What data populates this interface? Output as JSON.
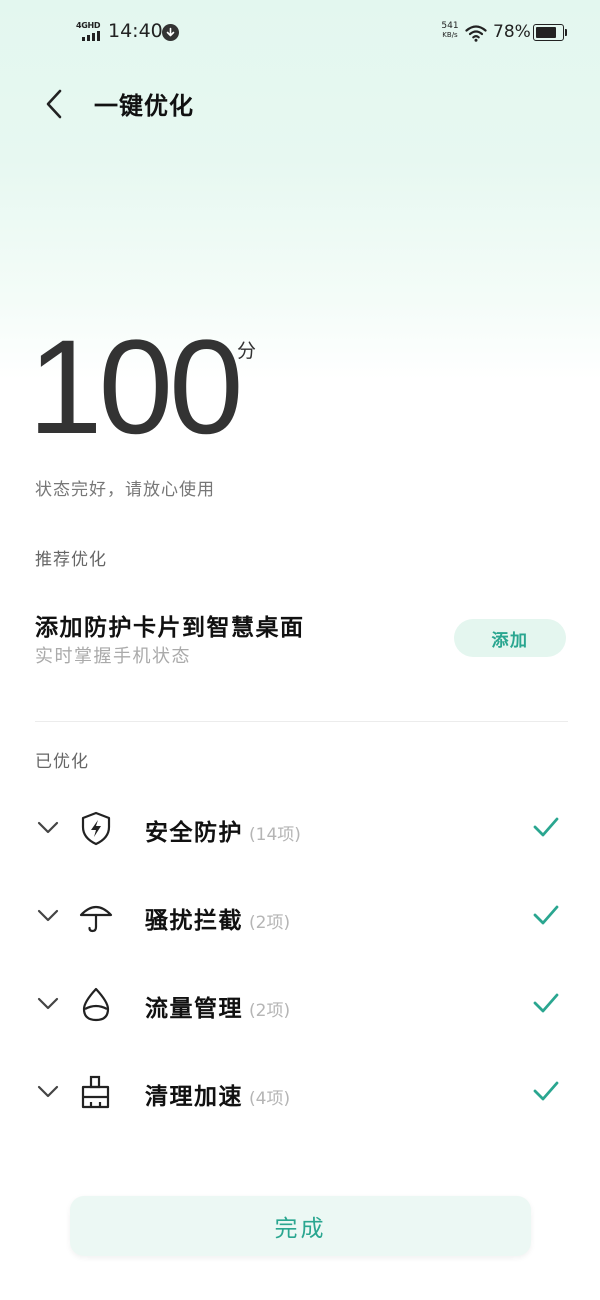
{
  "status_bar": {
    "network": "4GHD",
    "time": "14:40",
    "speed_value": "541",
    "speed_unit": "KB/s",
    "battery_percent": "78%",
    "battery_level": 0.78
  },
  "header": {
    "title": "一键优化",
    "back_icon": "chevron-left-icon"
  },
  "score": {
    "value": "100",
    "unit": "分",
    "status": "状态完好，请放心使用"
  },
  "recommend": {
    "section_label": "推荐优化",
    "title": "添加防护卡片到智慧桌面",
    "subtitle": "实时掌握手机状态",
    "button_label": "添加"
  },
  "optimized": {
    "section_label": "已优化",
    "items": [
      {
        "label": "安全防护",
        "count": "(14项)",
        "icon": "shield-bolt-icon",
        "status_icon": "check-icon"
      },
      {
        "label": "骚扰拦截",
        "count": "(2项)",
        "icon": "umbrella-icon",
        "status_icon": "check-icon"
      },
      {
        "label": "流量管理",
        "count": "(2项)",
        "icon": "water-drop-icon",
        "status_icon": "check-icon"
      },
      {
        "label": "清理加速",
        "count": "(4项)",
        "icon": "broom-icon",
        "status_icon": "check-icon"
      }
    ]
  },
  "footer": {
    "done_label": "完成"
  },
  "colors": {
    "accent": "#2aa690",
    "header_gradient_top": "#e3f7ef",
    "button_bg": "#e4f6ef",
    "text_primary": "#111111",
    "text_secondary": "#777777"
  }
}
